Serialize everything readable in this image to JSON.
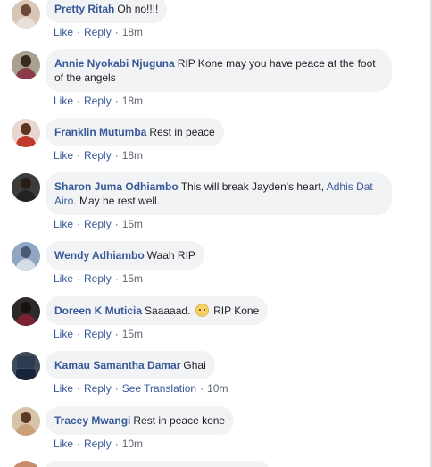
{
  "actions": {
    "like": "Like",
    "reply": "Reply",
    "see_translation": "See Translation",
    "separator": "·"
  },
  "comments": [
    {
      "author": "Pretty Ritah",
      "text": "Oh no!!!!",
      "time": "18m"
    },
    {
      "author": "Annie Nyokabi Njuguna",
      "text": "RIP Kone may you have peace at the foot of the angels",
      "time": "18m"
    },
    {
      "author": "Franklin Mutumba",
      "text": "Rest in peace",
      "time": "18m"
    },
    {
      "author": "Sharon Juma Odhiambo",
      "text_before": "This will break Jayden's heart,",
      "mention": "Adhis Dat Airo",
      "text_after": ". May he rest well.",
      "time": "15m"
    },
    {
      "author": "Wendy Adhiambo",
      "text": "Waah RIP",
      "time": "15m"
    },
    {
      "author": "Doreen K Muticia",
      "text_before": "Saaaaad.",
      "emoji": "sad-face-icon",
      "text_after": "RIP Kone",
      "time": "15m"
    },
    {
      "author": "Kamau Samantha Damar",
      "text": "Ghai",
      "time": "10m"
    },
    {
      "author": "Tracey Mwangi",
      "text": "Rest in peace kone",
      "time": "10m"
    }
  ],
  "colors": {
    "link": "#385898",
    "bubble": "#f2f3f5",
    "meta": "#606770"
  }
}
